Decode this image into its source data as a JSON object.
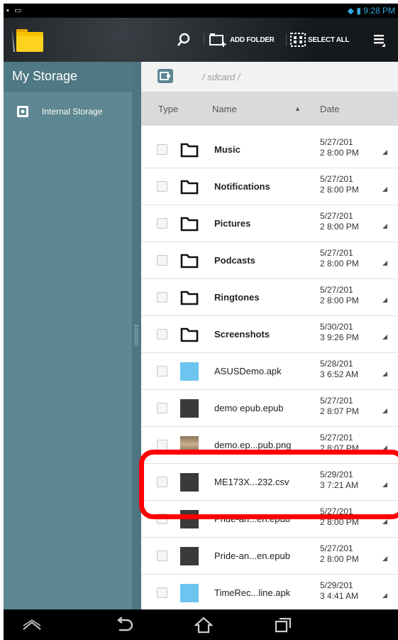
{
  "status_bar": {
    "time": "9:28 PM",
    "left_icons": [
      "notification-icon",
      "screenshot-icon"
    ],
    "right_icons": [
      "wifi-icon",
      "battery-icon"
    ]
  },
  "action_bar": {
    "app_icon": "folder-icon",
    "search_icon": "search-icon",
    "add_folder_label": "ADD FOLDER",
    "select_all_label": "SELECT ALL",
    "menu_icon": "menu-icon"
  },
  "sidebar": {
    "title": "My Storage",
    "items": [
      {
        "label": "Internal Storage",
        "icon": "storage-icon"
      }
    ]
  },
  "content": {
    "path": "/ sdcard /",
    "columns": {
      "type": "Type",
      "name": "Name",
      "date": "Date"
    },
    "files": [
      {
        "name": "Music",
        "date": "5/27/201\n2 8:00 PM",
        "kind": "folder"
      },
      {
        "name": "Notifications",
        "date": "5/27/201\n2 8:00 PM",
        "kind": "folder"
      },
      {
        "name": "Pictures",
        "date": "5/27/201\n2 8:00 PM",
        "kind": "folder"
      },
      {
        "name": "Podcasts",
        "date": "5/27/201\n2 8:00 PM",
        "kind": "folder"
      },
      {
        "name": "Ringtones",
        "date": "5/27/201\n2 8:00 PM",
        "kind": "folder"
      },
      {
        "name": "Screenshots",
        "date": "5/30/201\n3 9:26 PM",
        "kind": "folder"
      },
      {
        "name": "ASUSDemo.apk",
        "date": "5/28/201\n3 6:52 AM",
        "kind": "apk"
      },
      {
        "name": "demo epub.epub",
        "date": "5/27/201\n2 8:07 PM",
        "kind": "epub"
      },
      {
        "name": "demo.ep...pub.png",
        "date": "5/27/201\n2 8:07 PM",
        "kind": "png"
      },
      {
        "name": "ME173X...232.csv",
        "date": "5/29/201\n3 7:21 AM",
        "kind": "csv"
      },
      {
        "name": "Pride-an...en.epub",
        "date": "5/27/201\n2 8:00 PM",
        "kind": "epub"
      },
      {
        "name": "Pride-an...en.epub",
        "date": "5/27/201\n2 8:00 PM",
        "kind": "epub"
      },
      {
        "name": "TimeRec...line.apk",
        "date": "5/29/201\n3 4:41 AM",
        "kind": "apk"
      }
    ]
  },
  "nav_bar": {
    "buttons": [
      "up-icon",
      "back-icon",
      "home-icon",
      "recents-icon"
    ]
  },
  "colors": {
    "sidebar": "#5d8792",
    "highlight": "#ff0000",
    "header": "#dadada"
  }
}
